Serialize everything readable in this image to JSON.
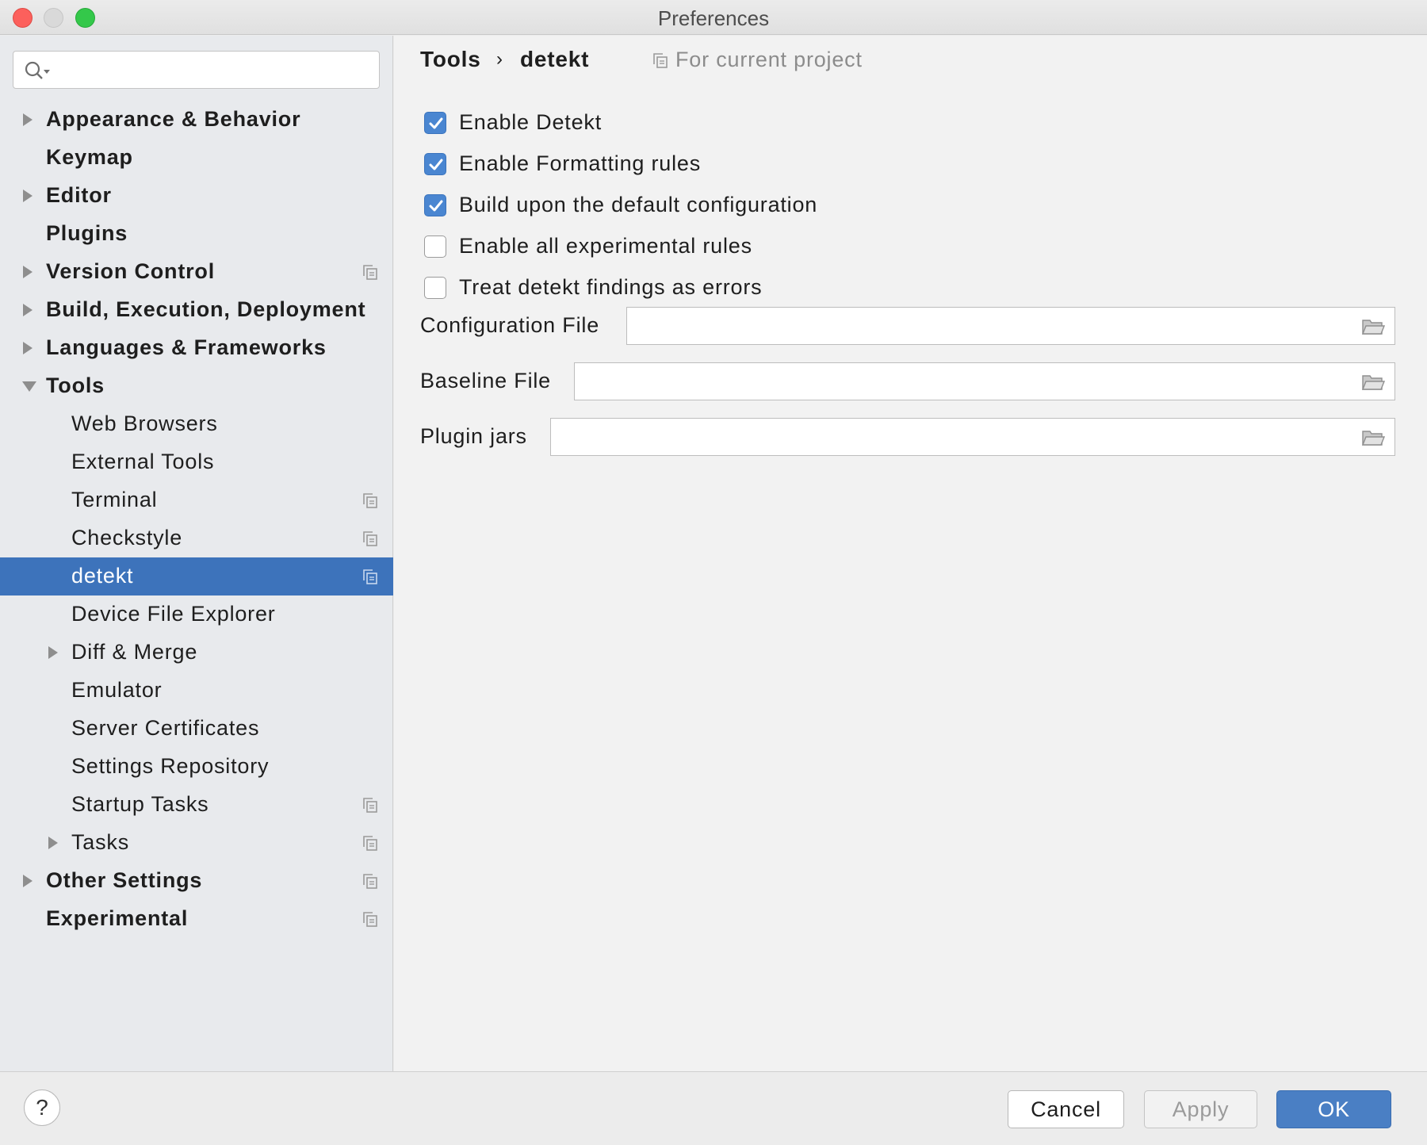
{
  "window": {
    "title": "Preferences"
  },
  "search": {
    "placeholder": "",
    "value": ""
  },
  "sidebar": {
    "items": [
      {
        "label": "Appearance & Behavior",
        "bold": true,
        "arrow": "right"
      },
      {
        "label": "Keymap",
        "bold": true
      },
      {
        "label": "Editor",
        "bold": true,
        "arrow": "right"
      },
      {
        "label": "Plugins",
        "bold": true
      },
      {
        "label": "Version Control",
        "bold": true,
        "arrow": "right",
        "project_icon": true
      },
      {
        "label": "Build, Execution, Deployment",
        "bold": true,
        "arrow": "right"
      },
      {
        "label": "Languages & Frameworks",
        "bold": true,
        "arrow": "right"
      },
      {
        "label": "Tools",
        "bold": true,
        "arrow": "down"
      },
      {
        "label": "Web Browsers"
      },
      {
        "label": "External Tools"
      },
      {
        "label": "Terminal",
        "project_icon": true
      },
      {
        "label": "Checkstyle",
        "project_icon": true
      },
      {
        "label": "detekt",
        "project_icon": true,
        "selected": true
      },
      {
        "label": "Device File Explorer"
      },
      {
        "label": "Diff & Merge",
        "arrow": "right"
      },
      {
        "label": "Emulator"
      },
      {
        "label": "Server Certificates"
      },
      {
        "label": "Settings Repository"
      },
      {
        "label": "Startup Tasks",
        "project_icon": true
      },
      {
        "label": "Tasks",
        "arrow": "right",
        "project_icon": true
      },
      {
        "label": "Other Settings",
        "bold": true,
        "arrow": "right",
        "project_icon": true
      },
      {
        "label": "Experimental",
        "bold": true,
        "project_icon": true
      }
    ]
  },
  "breadcrumb": {
    "parent": "Tools",
    "separator": "›",
    "current": "detekt",
    "scope": "For current project"
  },
  "options": [
    {
      "label": "Enable Detekt",
      "checked": true
    },
    {
      "label": "Enable Formatting rules",
      "checked": true
    },
    {
      "label": "Build upon the default configuration",
      "checked": true
    },
    {
      "label": "Enable all experimental rules",
      "checked": false
    },
    {
      "label": "Treat detekt findings as errors",
      "checked": false
    }
  ],
  "fields": [
    {
      "label": "Configuration File",
      "value": ""
    },
    {
      "label": "Baseline File",
      "value": ""
    },
    {
      "label": "Plugin jars",
      "value": ""
    }
  ],
  "footer": {
    "help": "?",
    "cancel": "Cancel",
    "apply": "Apply",
    "ok": "OK"
  },
  "colors": {
    "selection": "#3d73bb",
    "checkbox_on": "#4a86d1",
    "ok_button": "#4a7fc4"
  }
}
